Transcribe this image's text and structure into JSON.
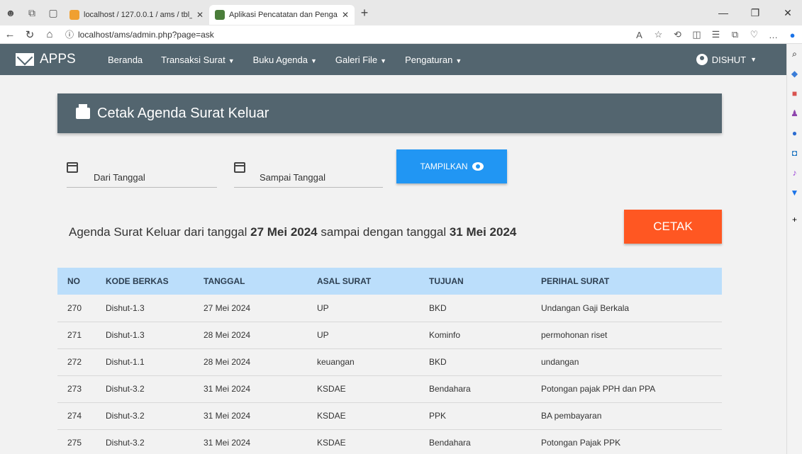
{
  "browser": {
    "tabs": [
      {
        "title": "localhost / 127.0.0.1 / ams / tbl_"
      },
      {
        "title": "Aplikasi Pencatatan dan Pengarsi"
      }
    ],
    "url": "localhost/ams/admin.php?page=ask"
  },
  "navbar": {
    "brand": "APPS",
    "menu": [
      "Beranda",
      "Transaksi Surat",
      "Buku Agenda",
      "Galeri File",
      "Pengaturan"
    ],
    "user": "DISHUT"
  },
  "card": {
    "title": "Cetak Agenda Surat Keluar"
  },
  "form": {
    "from_label": "Dari Tanggal",
    "to_label": "Sampai Tanggal",
    "show_button": "TAMPILKAN"
  },
  "summary": {
    "prefix": "Agenda Surat Keluar dari tanggal ",
    "date_from": "27 Mei 2024",
    "middle": " sampai dengan tanggal ",
    "date_to": "31 Mei 2024"
  },
  "print_button": "CETAK",
  "table": {
    "headers": [
      "NO",
      "KODE BERKAS",
      "TANGGAL",
      "ASAL SURAT",
      "TUJUAN",
      "PERIHAL SURAT"
    ],
    "rows": [
      [
        "270",
        "Dishut-1.3",
        "27 Mei 2024",
        "UP",
        "BKD",
        "Undangan Gaji Berkala"
      ],
      [
        "271",
        "Dishut-1.3",
        "28 Mei 2024",
        "UP",
        "Kominfo",
        "permohonan riset"
      ],
      [
        "272",
        "Dishut-1.1",
        "28 Mei 2024",
        "keuangan",
        "BKD",
        "undangan"
      ],
      [
        "273",
        "Dishut-3.2",
        "31 Mei 2024",
        "KSDAE",
        "Bendahara",
        "Potongan pajak PPH dan PPA"
      ],
      [
        "274",
        "Dishut-3.2",
        "31 Mei 2024",
        "KSDAE",
        "PPK",
        "BA pembayaran"
      ],
      [
        "275",
        "Dishut-3.2",
        "31 Mei 2024",
        "KSDAE",
        "Bendahara",
        "Potongan Pajak PPK"
      ]
    ]
  },
  "colors": {
    "navbar": "#53656f",
    "primary": "#2196f3",
    "accent": "#ff5722",
    "table_head": "#bbdefb"
  }
}
